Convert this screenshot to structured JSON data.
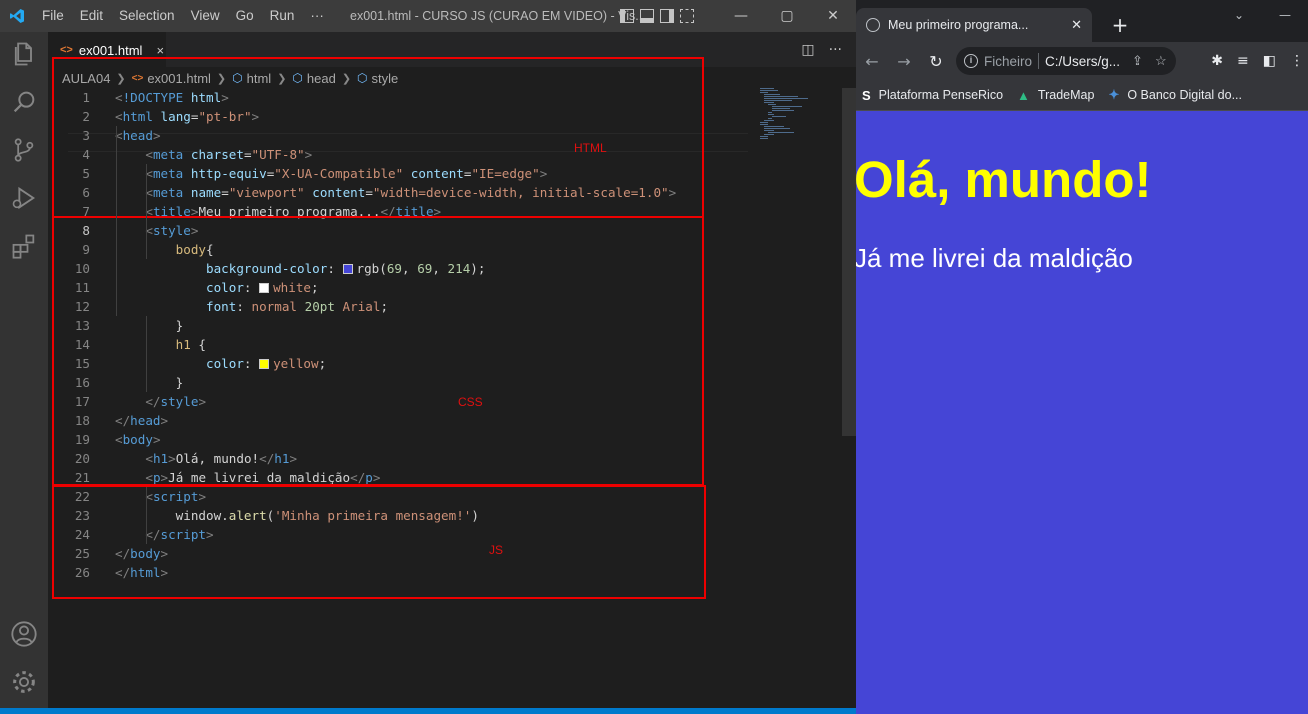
{
  "vscode": {
    "menu": [
      "File",
      "Edit",
      "Selection",
      "View",
      "Go",
      "Run",
      "···"
    ],
    "window_title": "ex001.html - CURSO JS (CURAO EM VIDEO) - Vis...",
    "win_buttons": [
      "—",
      "▢",
      "✕"
    ],
    "tab": {
      "label": "ex001.html",
      "close": "×"
    },
    "breadcrumb": [
      "AULA04",
      "ex001.html",
      "html",
      "head",
      "style"
    ],
    "annotations": {
      "html": "HTML",
      "css": "CSS",
      "js": "JS"
    },
    "code_lines": [
      {
        "n": "1",
        "html": "<span class='t-br'>&lt;</span><span class='t-tag'>!DOCTYPE</span> <span class='t-attr'>html</span><span class='t-br'>&gt;</span>"
      },
      {
        "n": "2",
        "html": "<span class='t-br'>&lt;</span><span class='t-tag'>html</span> <span class='t-attr'>lang</span>=<span class='t-str'>\"pt-br\"</span><span class='t-br'>&gt;</span>"
      },
      {
        "n": "3",
        "html": "<span class='t-br'>&lt;</span><span class='t-tag'>head</span><span class='t-br'>&gt;</span>"
      },
      {
        "n": "4",
        "html": "    <span class='t-br'>&lt;</span><span class='t-tag'>meta</span> <span class='t-attr'>charset</span>=<span class='t-str'>\"UTF-8\"</span><span class='t-br'>&gt;</span>"
      },
      {
        "n": "5",
        "html": "    <span class='t-br'>&lt;</span><span class='t-tag'>meta</span> <span class='t-attr'>http-equiv</span>=<span class='t-str'>\"X-UA-Compatible\"</span> <span class='t-attr'>content</span>=<span class='t-str'>\"IE=edge\"</span><span class='t-br'>&gt;</span>"
      },
      {
        "n": "6",
        "html": "    <span class='t-br'>&lt;</span><span class='t-tag'>meta</span> <span class='t-attr'>name</span>=<span class='t-str'>\"viewport\"</span> <span class='t-attr'>content</span>=<span class='t-str'>\"width=device-width, initial-scale=1.0\"</span><span class='t-br'>&gt;</span>"
      },
      {
        "n": "7",
        "html": "    <span class='t-br'>&lt;</span><span class='t-tag'>title</span><span class='t-br'>&gt;</span>Meu primeiro programa...<span class='t-br'>&lt;/</span><span class='t-tag'>title</span><span class='t-br'>&gt;</span>"
      },
      {
        "n": "8",
        "html": "    <span class='t-br'>&lt;</span><span class='t-tag'>style</span><span class='t-br'>&gt;</span>"
      },
      {
        "n": "9",
        "html": "        <span class='t-sel'>body</span>{"
      },
      {
        "n": "10",
        "html": "            <span class='t-prop'>background-color</span>: <span class='sw' style='background:#4545d6'></span>rgb(<span class='t-num'>69</span>, <span class='t-num'>69</span>, <span class='t-num'>214</span>);"
      },
      {
        "n": "11",
        "html": "            <span class='t-prop'>color</span>: <span class='sw' style='background:#ffffff'></span><span class='t-str'>white</span>;"
      },
      {
        "n": "12",
        "html": "            <span class='t-prop'>font</span>: <span class='t-str'>normal</span> <span class='t-num'>20pt</span> <span class='t-str'>Arial</span>;"
      },
      {
        "n": "13",
        "html": "        }"
      },
      {
        "n": "14",
        "html": "        <span class='t-sel'>h1</span> {"
      },
      {
        "n": "15",
        "html": "            <span class='t-prop'>color</span>: <span class='sw' style='background:#ffff00'></span><span class='t-str'>yellow</span>;"
      },
      {
        "n": "16",
        "html": "        }"
      },
      {
        "n": "17",
        "html": "    <span class='t-br'>&lt;/</span><span class='t-tag'>style</span><span class='t-br'>&gt;</span>"
      },
      {
        "n": "18",
        "html": "<span class='t-br'>&lt;/</span><span class='t-tag'>head</span><span class='t-br'>&gt;</span>"
      },
      {
        "n": "19",
        "html": "<span class='t-br'>&lt;</span><span class='t-tag'>body</span><span class='t-br'>&gt;</span>"
      },
      {
        "n": "20",
        "html": "    <span class='t-br'>&lt;</span><span class='t-tag'>h1</span><span class='t-br'>&gt;</span>Olá, mundo!<span class='t-br'>&lt;/</span><span class='t-tag'>h1</span><span class='t-br'>&gt;</span>"
      },
      {
        "n": "21",
        "html": "    <span class='t-br'>&lt;</span><span class='t-tag'>p</span><span class='t-br'>&gt;</span>Já me livrei da maldição<span class='t-br'>&lt;/</span><span class='t-tag'>p</span><span class='t-br'>&gt;</span>"
      },
      {
        "n": "22",
        "html": "    <span class='t-br'>&lt;</span><span class='t-tag'>script</span><span class='t-br'>&gt;</span>"
      },
      {
        "n": "23",
        "html": "        window.<span class='t-fn'>alert</span>(<span class='t-str'>'Minha primeira mensagem!'</span>)"
      },
      {
        "n": "24",
        "html": "    <span class='t-br'>&lt;/</span><span class='t-tag'>script</span><span class='t-br'>&gt;</span>"
      },
      {
        "n": "25",
        "html": "<span class='t-br'>&lt;/</span><span class='t-tag'>body</span><span class='t-br'>&gt;</span>"
      },
      {
        "n": "26",
        "html": "<span class='t-br'>&lt;/</span><span class='t-tag'>html</span><span class='t-br'>&gt;</span>"
      }
    ],
    "active_line": "8"
  },
  "chrome": {
    "tab_title": "Meu primeiro programa...",
    "tab_close": "✕",
    "new_tab": "+",
    "address_label": "Ficheiro",
    "address_url": "C:/Users/g...",
    "bookmarks": [
      {
        "icon": "S",
        "label": "Plataforma PenseRico",
        "color": "#ffffff"
      },
      {
        "icon": "▲",
        "label": "TradeMap",
        "color": "#2ebd85"
      },
      {
        "icon": "✦",
        "label": "O Banco Digital do...",
        "color": "#4a90d9"
      }
    ]
  },
  "page": {
    "h1": "Olá, mundo!",
    "p": "Já me livrei da maldição",
    "background": "#4545d6",
    "h1_color": "#ffff00",
    "text_color": "#ffffff"
  }
}
